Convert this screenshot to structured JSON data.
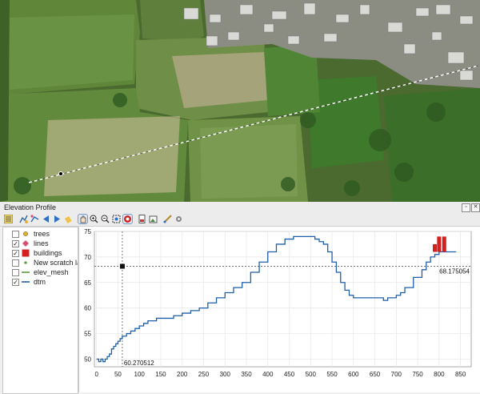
{
  "panel": {
    "title": "Elevation Profile"
  },
  "toolbar": {
    "icons": [
      "layer-tree-icon",
      "capture-curve-icon",
      "capture-curve-from-feature-icon",
      "nudge-left-icon",
      "nudge-right-icon",
      "clear-icon",
      "pan-icon",
      "zoom-in-icon",
      "zoom-out-icon",
      "zoom-full-icon",
      "identify-icon",
      "export-pdf-icon",
      "export-image-icon",
      "measure-icon",
      "settings-icon"
    ]
  },
  "layers": [
    {
      "name": "trees",
      "checked": false,
      "symbol": "point",
      "color": "#e3b130"
    },
    {
      "name": "lines",
      "checked": true,
      "symbol": "diamond",
      "color": "#d8506f"
    },
    {
      "name": "buildings",
      "checked": true,
      "symbol": "fill",
      "color": "#d52020"
    },
    {
      "name": "New scratch layer",
      "checked": false,
      "symbol": "point-small",
      "color": "#6aa04a"
    },
    {
      "name": "elev_mesh",
      "checked": false,
      "symbol": "line",
      "color": "#5a9c3c"
    },
    {
      "name": "dtm",
      "checked": true,
      "symbol": "line",
      "color": "#1f5fa8"
    }
  ],
  "readout": {
    "x_value": "60.270512",
    "y_value": "68.175054"
  },
  "chart_data": {
    "type": "line",
    "x_ticks": [
      "0",
      "50",
      "100",
      "150",
      "200",
      "250",
      "300",
      "350",
      "400",
      "450",
      "500",
      "550",
      "600",
      "650",
      "700",
      "750",
      "800",
      "850"
    ],
    "y_ticks": [
      "50",
      "55",
      "60",
      "65",
      "70",
      "75"
    ],
    "xlim": [
      -5,
      875
    ],
    "ylim": [
      48.5,
      75
    ],
    "grid": true,
    "cursor": {
      "x": 60.270512,
      "y": 68.175054
    },
    "series": [
      {
        "style": "line",
        "color": "#1f5fa8",
        "x": [
          0,
          5,
          10,
          15,
          20,
          25,
          30,
          35,
          40,
          45,
          50,
          55,
          60,
          70,
          80,
          90,
          100,
          110,
          120,
          140,
          160,
          180,
          200,
          220,
          240,
          260,
          280,
          300,
          320,
          340,
          360,
          380,
          400,
          420,
          440,
          460,
          480,
          490,
          500,
          510,
          520,
          530,
          540,
          550,
          560,
          570,
          580,
          590,
          600,
          620,
          640,
          660,
          670,
          680,
          690,
          700,
          710,
          720,
          740,
          760,
          770,
          780,
          790,
          800,
          820,
          840
        ],
        "y": [
          50,
          49.5,
          50,
          49.5,
          50,
          50.5,
          51,
          52,
          52.5,
          53,
          53.5,
          54,
          54.5,
          55,
          55.5,
          56,
          56.5,
          57,
          57.5,
          58,
          58,
          58.5,
          59,
          59.5,
          60,
          61,
          62,
          63,
          64,
          65,
          67,
          69,
          71,
          72.5,
          73.5,
          74,
          74,
          74,
          74,
          73.5,
          73,
          72.5,
          71,
          69,
          67,
          65,
          63.5,
          62.5,
          62,
          62,
          62,
          62,
          61.5,
          62,
          62,
          62.5,
          63,
          64,
          66,
          67.5,
          69,
          70,
          70.5,
          71,
          71,
          71
        ]
      },
      {
        "style": "bars",
        "color": "#d52020",
        "x": [
          790,
          800,
          812
        ],
        "y": [
          72.5,
          74,
          74
        ]
      }
    ]
  }
}
